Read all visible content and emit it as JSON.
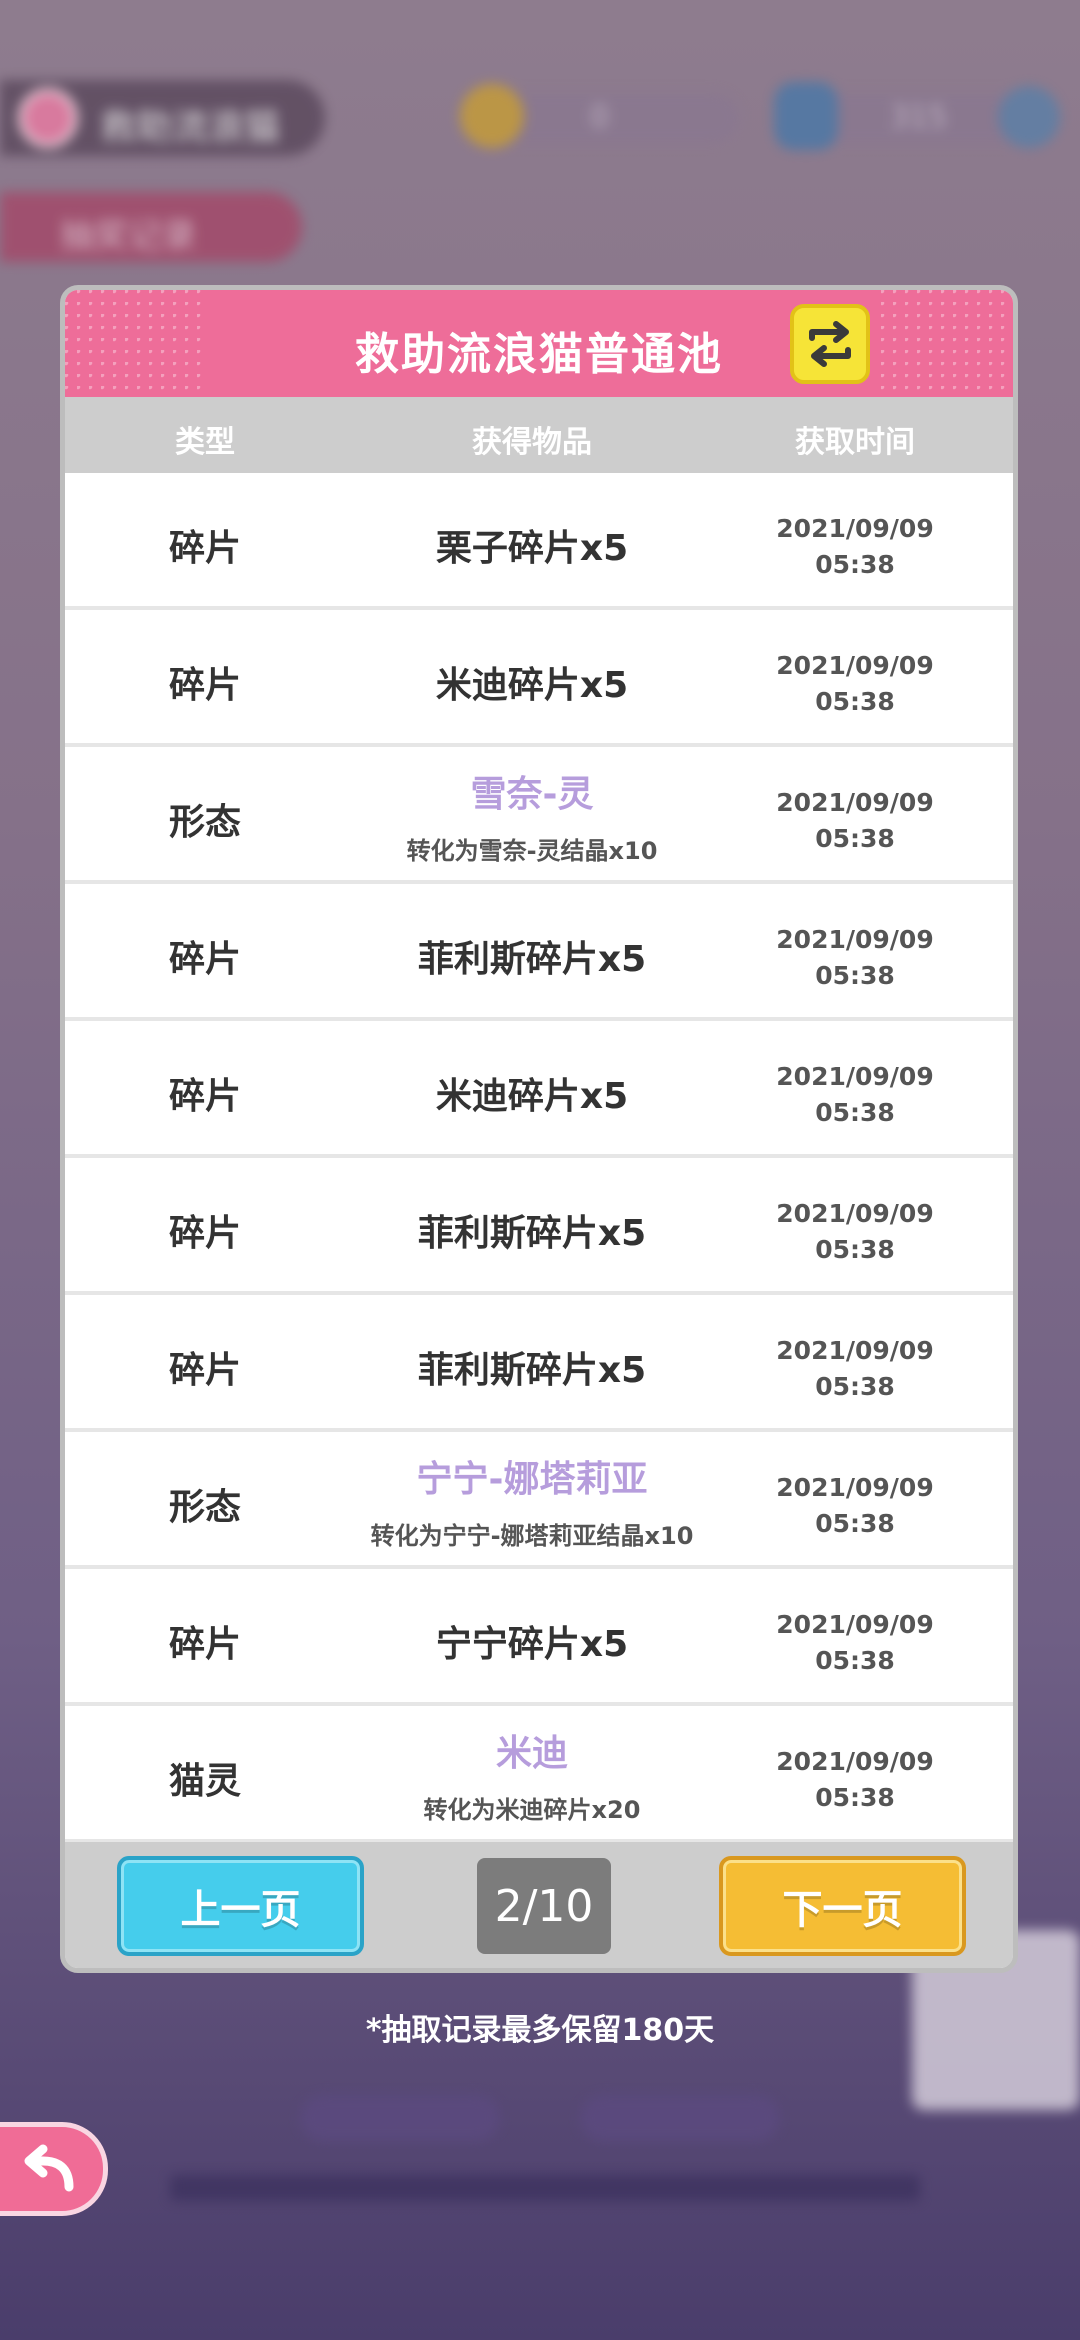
{
  "background": {
    "title": "救助流浪猫",
    "coins": "0",
    "gems": "315",
    "record_tab": "抽奖记录"
  },
  "dialog": {
    "title": "救助流浪猫普通池",
    "columns": {
      "type": "类型",
      "item": "获得物品",
      "time": "获取时间"
    },
    "rows": [
      {
        "type": "碎片",
        "item": "栗子碎片x5",
        "rare": false,
        "date": "2021/09/09",
        "clock": "05:38"
      },
      {
        "type": "碎片",
        "item": "米迪碎片x5",
        "rare": false,
        "date": "2021/09/09",
        "clock": "05:38"
      },
      {
        "type": "形态",
        "item": "雪奈-灵",
        "sub": "转化为雪奈-灵结晶x10",
        "rare": true,
        "date": "2021/09/09",
        "clock": "05:38"
      },
      {
        "type": "碎片",
        "item": "菲利斯碎片x5",
        "rare": false,
        "date": "2021/09/09",
        "clock": "05:38"
      },
      {
        "type": "碎片",
        "item": "米迪碎片x5",
        "rare": false,
        "date": "2021/09/09",
        "clock": "05:38"
      },
      {
        "type": "碎片",
        "item": "菲利斯碎片x5",
        "rare": false,
        "date": "2021/09/09",
        "clock": "05:38"
      },
      {
        "type": "碎片",
        "item": "菲利斯碎片x5",
        "rare": false,
        "date": "2021/09/09",
        "clock": "05:38"
      },
      {
        "type": "形态",
        "item": "宁宁-娜塔莉亚",
        "sub": "转化为宁宁-娜塔莉亚结晶x10",
        "rare": true,
        "date": "2021/09/09",
        "clock": "05:38"
      },
      {
        "type": "碎片",
        "item": "宁宁碎片x5",
        "rare": false,
        "date": "2021/09/09",
        "clock": "05:38"
      },
      {
        "type": "猫灵",
        "item": "米迪",
        "sub": "转化为米迪碎片x20",
        "rare": true,
        "date": "2021/09/09",
        "clock": "05:38"
      }
    ],
    "prev_label": "上一页",
    "next_label": "下一页",
    "page": "2/10"
  },
  "retention_note": "*抽取记录最多保留180天",
  "icons": {
    "switch": "swap-arrows-icon",
    "back": "back-arrow-icon"
  },
  "colors": {
    "header_pink": "#ee6d99",
    "rare_purple": "#b69ddc",
    "prev_blue": "#45cdec",
    "next_orange": "#f5bd34",
    "switch_yellow": "#f6e437"
  }
}
